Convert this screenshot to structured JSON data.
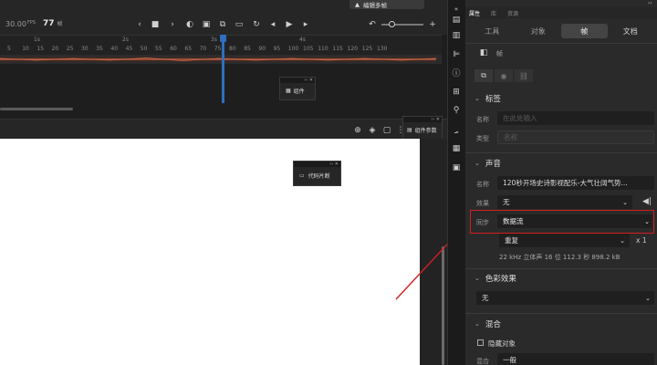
{
  "timeline": {
    "fps": "30.00",
    "fps_unit": "FPS",
    "frame": "77",
    "frame_unit": "帧",
    "ruler": [
      "5",
      "10",
      "15",
      "20",
      "25",
      "30",
      "35",
      "40",
      "45",
      "50",
      "55",
      "60",
      "65",
      "70",
      "75",
      "80",
      "85",
      "90",
      "95",
      "100",
      "105",
      "110",
      "115",
      "120",
      "125",
      "130"
    ],
    "seconds": [
      "1s",
      "2s",
      "3s",
      "4s"
    ],
    "edit_multiple_frames": "编辑多帧",
    "current_frame_percent": 0.57
  },
  "floating_panels": {
    "components": "组件",
    "component_params": "组件参数",
    "code_snippets": "代码片断"
  },
  "side_toolbar": {
    "icons": [
      "properties-icon",
      "library-icon",
      "align-icon",
      "info-icon",
      "transform-icon",
      "color-icon",
      "motion-icon",
      "components-icon",
      "code-icon"
    ]
  },
  "properties": {
    "header_tabs": [
      "属性",
      "库",
      "资源"
    ],
    "tabs": [
      "工具",
      "对象",
      "帧",
      "文档"
    ],
    "active_tab_index": 2,
    "frame_title": "帧",
    "label_section": "标签",
    "name_label": "名称",
    "name_placeholder": "在此处输入",
    "type_label": "类型",
    "type_value": "名称",
    "sound_section": "声音",
    "sound_name_label": "名称",
    "sound_name_value": "120秒开场史诗影视配乐-大气壮阔气势...",
    "effect_label": "效果",
    "effect_value": "无",
    "sync_label": "同步",
    "sync_value": "数据流",
    "repeat_value": "重复",
    "repeat_count": "x 1",
    "sound_info": "22 kHz 立体声 16 位 112.3 秒 898.2 kB",
    "color_effect_section": "色彩效果",
    "color_effect_value": "无",
    "blend_section": "混合",
    "hide_object_label": "隐藏对象",
    "blend_label": "混合",
    "blend_value": "一般"
  },
  "colors": {
    "accent_red": "#d21f1f",
    "playhead_blue": "#2f6fbf",
    "waveform": "#b4563a"
  }
}
